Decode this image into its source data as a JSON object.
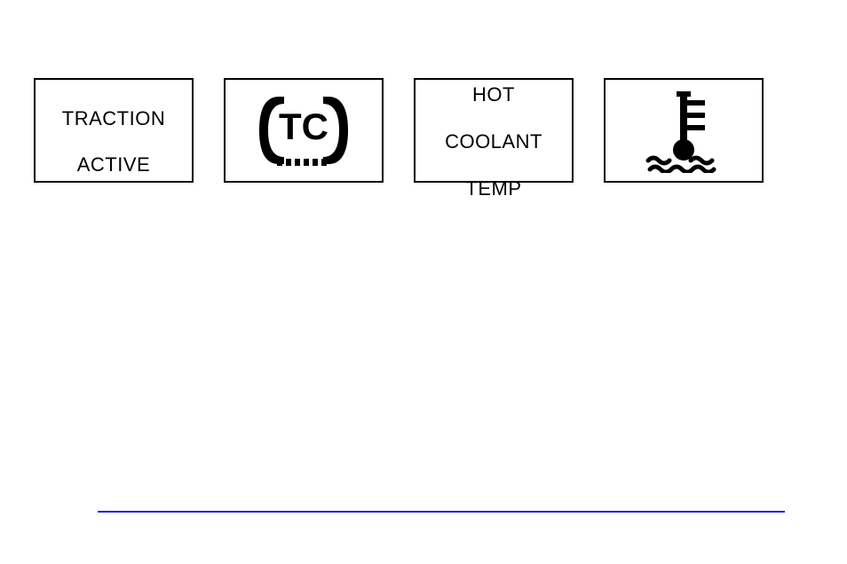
{
  "indicators": {
    "traction_active": {
      "line1": "TRACTION",
      "line2": "ACTIVE"
    },
    "tc_symbol": {
      "text": "TC"
    },
    "hot_coolant": {
      "line1": "HOT",
      "line2": "COOLANT",
      "line3": "TEMP"
    }
  }
}
